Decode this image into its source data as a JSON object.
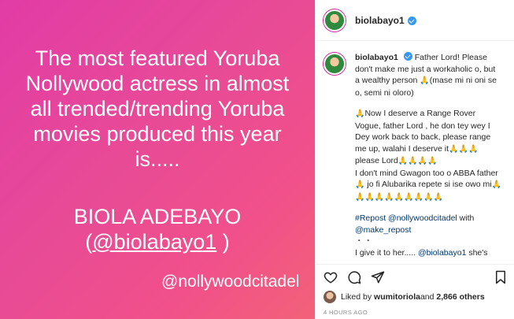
{
  "media": {
    "headline_lines": [
      "The most featured Yoruba",
      "Nollywood actress in almost",
      "all trended/trending Yoruba",
      "movies produced this year",
      "is....."
    ],
    "name": "BIOLA ADEBAYO",
    "handle_open": "(",
    "handle": "@biolabayo1",
    "handle_close": " )",
    "watermark": "@nollywoodcitadel"
  },
  "post": {
    "username": "biolabayo1",
    "caption_username": "biolabayo1",
    "caption_p1": "Father Lord! Please don't make me just a workaholic o, but a wealthy person",
    "caption_p1_tail": "(mase mi ni oni se o, semi ni oloro)",
    "caption_p2_a": "Now I deserve a Range Rover Vogue, father Lord , he don tey wey I Dey work back to back, please range me up, walahi I deserve it",
    "caption_p2_b": "please Lord",
    "caption_p2_c": "I don't mind Gwagon too o ABBA father",
    "caption_p2_d": "jo fi Alubarika repete si ise owo mi",
    "repost_tag": "#Repost",
    "repost_mention": "@nollywoodcitadel",
    "repost_with": " with",
    "repost_tool": "@make_repost",
    "dots": "・・",
    "last_line_a": "I give it to her.....",
    "last_line_mention": "@biolabayo1",
    "last_line_b": " she's",
    "pray_1": "🙏",
    "pray_3": "🙏🙏🙏",
    "pray_4": "🙏🙏🙏🙏",
    "pray_many": "🙏🙏🙏🙏🙏🙏🙏🙏🙏🙏"
  },
  "likes": {
    "prefix": "Liked by ",
    "user": "wumitoriola",
    "middle": " and ",
    "count": "2,866 others"
  },
  "time": "4 HOURS AGO",
  "icons": [
    "heart-icon",
    "comment-icon",
    "share-icon",
    "bookmark-icon",
    "verified-badge-icon"
  ],
  "colors": {
    "accent_gradient_start": "#e23ba6",
    "accent_gradient_end": "#f26278",
    "link": "#00376b",
    "verified": "#3897f0"
  }
}
